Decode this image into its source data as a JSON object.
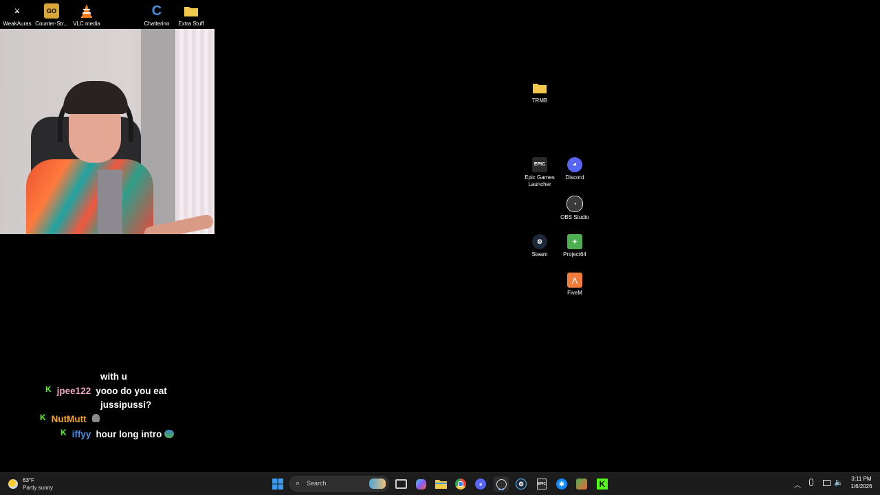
{
  "desktop_icons": [
    {
      "name": "weakauras",
      "label": "WeakAuras Companion",
      "icon": "weakauras-icon",
      "color": "#ffffff"
    },
    {
      "name": "counter-strike",
      "label": "Counter-Str... Global Off...",
      "icon": "csgo-icon",
      "color": "#d8a637"
    },
    {
      "name": "vlc",
      "label": "VLC media player",
      "icon": "vlc-cone-icon",
      "color": "#f47f19"
    },
    {
      "name": "chatterino",
      "label": "Chatterino",
      "icon": "chatterino-icon",
      "color": "#4a8fd8"
    },
    {
      "name": "extra-stuff",
      "label": "Extra Stuff",
      "icon": "folder-icon",
      "color": "#f2c94c"
    },
    {
      "name": "trmb",
      "label": "TRMB",
      "icon": "folder-icon",
      "color": "#f2c94c"
    },
    {
      "name": "epic-games",
      "label": "Epic Games Launcher",
      "icon": "epic-games-icon",
      "color": "#2a2a2a"
    },
    {
      "name": "discord",
      "label": "Discord",
      "icon": "discord-icon",
      "color": "#5865f2"
    },
    {
      "name": "obs",
      "label": "OBS Studio",
      "icon": "obs-icon",
      "color": "#3a3a3a"
    },
    {
      "name": "steam",
      "label": "Steam",
      "icon": "steam-icon",
      "color": "#1b2838"
    },
    {
      "name": "project64",
      "label": "Project64",
      "icon": "project64-icon",
      "color": "#4caf50"
    },
    {
      "name": "fivem",
      "label": "FiveM",
      "icon": "fivem-icon",
      "color": "#f07b3a"
    }
  ],
  "chat": {
    "badge_glyph": "K",
    "messages": [
      {
        "user": "",
        "user_color": "#ffffff",
        "text": "with u"
      },
      {
        "user": "jpee122",
        "user_color": "#f4a6c8",
        "text": "yooo do you eat"
      },
      {
        "user": "",
        "user_color": "#ffffff",
        "text": "jussipussi?"
      },
      {
        "user": "NutMutt",
        "user_color": "#f5a623",
        "text": ""
      },
      {
        "user": "iffyy",
        "user_color": "#4a90e2",
        "text": "hour long intro"
      }
    ]
  },
  "taskbar": {
    "weather": {
      "temp": "63°F",
      "condition": "Partly sunny",
      "icon": "partly-sunny-icon"
    },
    "search_placeholder": "Search",
    "pinned": [
      {
        "name": "start",
        "icon": "windows-start-icon",
        "color": "#3a9bf0"
      },
      {
        "name": "task-view",
        "icon": "task-view-icon",
        "color": "#cfcfcf"
      },
      {
        "name": "copilot",
        "icon": "copilot-icon",
        "color": "#6a6af0"
      },
      {
        "name": "file-explorer",
        "icon": "file-explorer-icon",
        "color": "#f2c94c"
      },
      {
        "name": "chrome",
        "icon": "chrome-icon",
        "color": "#e9473b"
      },
      {
        "name": "discord",
        "icon": "discord-icon",
        "color": "#5865f2"
      },
      {
        "name": "obs",
        "icon": "obs-icon",
        "color": "#3a3a3a"
      },
      {
        "name": "steam",
        "icon": "steam-icon",
        "color": "#1b2838"
      },
      {
        "name": "epic",
        "icon": "epic-games-icon",
        "color": "#2a2a2a"
      },
      {
        "name": "battlenet",
        "icon": "battlenet-icon",
        "color": "#148eff"
      },
      {
        "name": "project64",
        "icon": "project64-icon",
        "color": "#4caf50"
      },
      {
        "name": "kick",
        "icon": "kick-icon",
        "color": "#53fc18"
      }
    ],
    "clock": {
      "time": "3:11 PM",
      "date": "1/6/2026"
    }
  }
}
